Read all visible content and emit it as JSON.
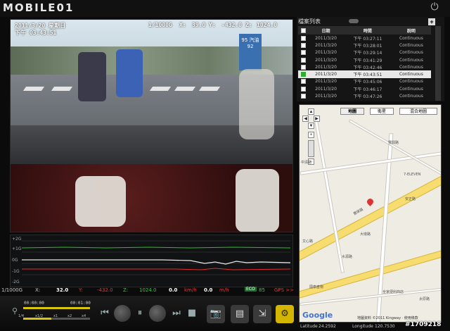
{
  "app": {
    "logo": "MOBILE01",
    "power_icon": "power-icon"
  },
  "video_osd": {
    "date": "2011/3/20 星期日",
    "time": "下午 03:43:51",
    "resolution": "1/1000G",
    "x_label": "X:",
    "x_value": "39.0",
    "y_label": "Y:",
    "y_value": "-432.0",
    "z_label": "Z:",
    "z_value": "1024.0",
    "sign_text": "95 汽油 92"
  },
  "waveform": {
    "labels": [
      "+2G",
      "+1G",
      "0G",
      "-1G",
      "-2G"
    ],
    "colors": {
      "green": "#22c122",
      "white": "#e8e8e8",
      "red": "#e22b2b"
    }
  },
  "readout": {
    "resolution": "1/1000G",
    "x_label": "X:",
    "x_value": "32.0",
    "y_label": "Y:",
    "y_value": "-432.0",
    "z_label": "Z:",
    "z_value": "1024.0",
    "speed_value": "0.0",
    "speed_unit": "km/h",
    "mph_value": "0.0",
    "mph_unit": "m/h",
    "eco_badge": "ECO",
    "eco_value": "85",
    "gps_label": "GPS >>"
  },
  "playback": {
    "time_start": "00:00:00",
    "time_end": "00:01:00",
    "speeds": [
      "1/4",
      "x1/2",
      "x1",
      "x2",
      "x4"
    ],
    "progress": 0.0
  },
  "file_list": {
    "title": "檔案列表",
    "headers": {
      "date": "日期",
      "time": "時間",
      "desc": "說明"
    },
    "rows": [
      {
        "date": "2011/3/20",
        "time": "下午 03:27:11",
        "desc": "Continuous",
        "checked": false,
        "selected": false
      },
      {
        "date": "2011/3/20",
        "time": "下午 03:28:01",
        "desc": "Continuous",
        "checked": false,
        "selected": false
      },
      {
        "date": "2011/3/20",
        "time": "下午 03:29:14",
        "desc": "Continuous",
        "checked": false,
        "selected": false
      },
      {
        "date": "2011/3/20",
        "time": "下午 03:41:29",
        "desc": "Continuous",
        "checked": false,
        "selected": false
      },
      {
        "date": "2011/3/20",
        "time": "下午 03:42:46",
        "desc": "Continuous",
        "checked": false,
        "selected": false
      },
      {
        "date": "2011/3/20",
        "time": "下午 03:43:51",
        "desc": "Continuous",
        "checked": true,
        "selected": true
      },
      {
        "date": "2011/3/20",
        "time": "下午 03:45:06",
        "desc": "Continuous",
        "checked": false,
        "selected": false
      },
      {
        "date": "2011/3/20",
        "time": "下午 03:46:17",
        "desc": "Continuous",
        "checked": false,
        "selected": false
      },
      {
        "date": "2011/3/20",
        "time": "下午 03:47:26",
        "desc": "Continuous",
        "checked": false,
        "selected": false
      }
    ]
  },
  "map": {
    "tabs": [
      "地圖",
      "衛星",
      "混合地圖"
    ],
    "labels": [
      "7-ELEVEN",
      "豐榮路",
      "安正路",
      "豐興路",
      "中清路",
      "水源路",
      "文心路",
      "大墩路",
      "全家便利商店",
      "國泰產物",
      "太原路"
    ],
    "google": "Google",
    "credit": "地圖資料 ©2011 Kingway · 使用條款"
  },
  "gps": {
    "lat_label": "Latitude",
    "lat_value": "24.2592",
    "lng_label": "Longitude",
    "lng_value": "120.7530"
  },
  "watermark": "#1709218"
}
